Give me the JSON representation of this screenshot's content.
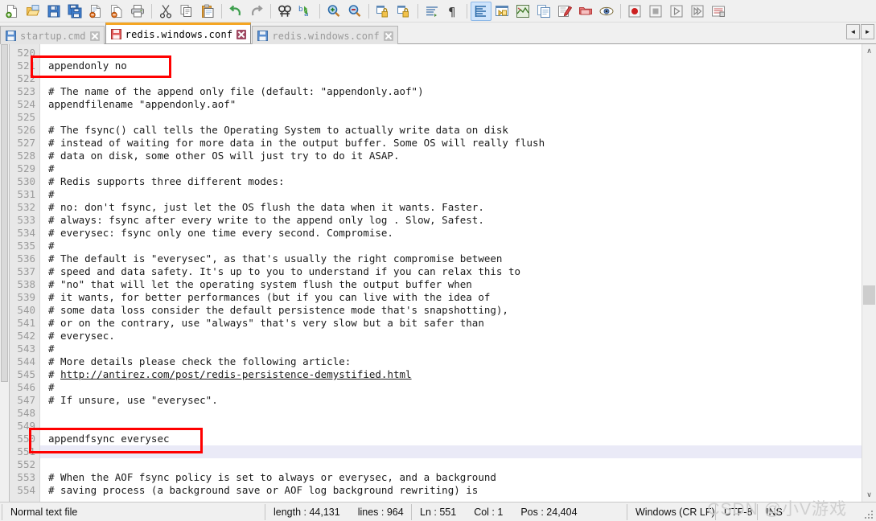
{
  "toolbar": {
    "items": [
      {
        "name": "new-file-icon",
        "label": "New"
      },
      {
        "name": "open-file-icon",
        "label": "Open"
      },
      {
        "name": "save-icon",
        "label": "Save"
      },
      {
        "name": "save-all-icon",
        "label": "Save All"
      },
      {
        "name": "close-file-icon",
        "label": "Close"
      },
      {
        "name": "close-all-icon",
        "label": "Close All"
      },
      {
        "name": "print-icon",
        "label": "Print"
      },
      {
        "name": "separator-1",
        "label": ""
      },
      {
        "name": "cut-icon",
        "label": "Cut"
      },
      {
        "name": "copy-icon",
        "label": "Copy"
      },
      {
        "name": "paste-icon",
        "label": "Paste"
      },
      {
        "name": "separator-2",
        "label": ""
      },
      {
        "name": "undo-icon",
        "label": "Undo"
      },
      {
        "name": "redo-icon",
        "label": "Redo"
      },
      {
        "name": "separator-3",
        "label": ""
      },
      {
        "name": "find-icon",
        "label": "Find"
      },
      {
        "name": "replace-icon",
        "label": "Replace"
      },
      {
        "name": "separator-4",
        "label": ""
      },
      {
        "name": "zoom-in-icon",
        "label": "Zoom In"
      },
      {
        "name": "zoom-out-icon",
        "label": "Zoom Out"
      },
      {
        "name": "separator-5",
        "label": ""
      },
      {
        "name": "sync-vertical-scroll-icon",
        "label": "Synchronize Vertical Scrolling"
      },
      {
        "name": "sync-horizontal-scroll-icon",
        "label": "Synchronize Horizontal Scrolling"
      },
      {
        "name": "separator-6",
        "label": ""
      },
      {
        "name": "word-wrap-icon",
        "label": "Word wrap"
      },
      {
        "name": "show-all-characters-icon",
        "label": "Show All Characters"
      },
      {
        "name": "separator-7",
        "label": ""
      },
      {
        "name": "show-indent-guide-icon",
        "label": "Show Indent Guide"
      },
      {
        "name": "user-defined-dialog-icon",
        "label": "User-Defined Dialogue"
      },
      {
        "name": "document-map-icon",
        "label": "Document Map"
      },
      {
        "name": "function-list-icon",
        "label": "Function List"
      },
      {
        "name": "folder-as-workspace-icon",
        "label": "Folder as Workspace"
      },
      {
        "name": "monitoring-icon",
        "label": "Monitoring"
      },
      {
        "name": "separator-8",
        "label": ""
      },
      {
        "name": "record-macro-icon",
        "label": "Start Recording"
      },
      {
        "name": "stop-macro-icon",
        "label": "Stop Recording"
      },
      {
        "name": "play-macro-icon",
        "label": "Playback"
      },
      {
        "name": "run-macro-multiple-icon",
        "label": "Run a Macro Multiple Times"
      },
      {
        "name": "save-macro-icon",
        "label": "Save Current Recorded Macro"
      }
    ]
  },
  "tabs": [
    {
      "label": "startup.cmd",
      "active": false,
      "saved": true
    },
    {
      "label": "redis.windows.conf",
      "active": true,
      "saved": false
    },
    {
      "label": "redis.windows.conf",
      "active": false,
      "saved": true
    }
  ],
  "tab_scroll": {
    "left": "◄",
    "right": "►"
  },
  "editor": {
    "first_line": 520,
    "current_line": 551,
    "lines": [
      {
        "n": 520,
        "text": ""
      },
      {
        "n": 521,
        "text": "appendonly no"
      },
      {
        "n": 522,
        "text": ""
      },
      {
        "n": 523,
        "text": "# The name of the append only file (default: \"appendonly.aof\")"
      },
      {
        "n": 524,
        "text": "appendfilename \"appendonly.aof\""
      },
      {
        "n": 525,
        "text": ""
      },
      {
        "n": 526,
        "text": "# The fsync() call tells the Operating System to actually write data on disk"
      },
      {
        "n": 527,
        "text": "# instead of waiting for more data in the output buffer. Some OS will really flush"
      },
      {
        "n": 528,
        "text": "# data on disk, some other OS will just try to do it ASAP."
      },
      {
        "n": 529,
        "text": "#"
      },
      {
        "n": 530,
        "text": "# Redis supports three different modes:"
      },
      {
        "n": 531,
        "text": "#"
      },
      {
        "n": 532,
        "text": "# no: don't fsync, just let the OS flush the data when it wants. Faster."
      },
      {
        "n": 533,
        "text": "# always: fsync after every write to the append only log . Slow, Safest."
      },
      {
        "n": 534,
        "text": "# everysec: fsync only one time every second. Compromise."
      },
      {
        "n": 535,
        "text": "#"
      },
      {
        "n": 536,
        "text": "# The default is \"everysec\", as that's usually the right compromise between"
      },
      {
        "n": 537,
        "text": "# speed and data safety. It's up to you to understand if you can relax this to"
      },
      {
        "n": 538,
        "text": "# \"no\" that will let the operating system flush the output buffer when"
      },
      {
        "n": 539,
        "text": "# it wants, for better performances (but if you can live with the idea of"
      },
      {
        "n": 540,
        "text": "# some data loss consider the default persistence mode that's snapshotting),"
      },
      {
        "n": 541,
        "text": "# or on the contrary, use \"always\" that's very slow but a bit safer than"
      },
      {
        "n": 542,
        "text": "# everysec."
      },
      {
        "n": 543,
        "text": "#"
      },
      {
        "n": 544,
        "text": "# More details please check the following article:"
      },
      {
        "n": 545,
        "text": "# http://antirez.com/post/redis-persistence-demystified.html",
        "url": "http://antirez.com/post/redis-persistence-demystified.html",
        "prefix": "# "
      },
      {
        "n": 546,
        "text": "#"
      },
      {
        "n": 547,
        "text": "# If unsure, use \"everysec\"."
      },
      {
        "n": 548,
        "text": ""
      },
      {
        "n": 549,
        "text": ""
      },
      {
        "n": 550,
        "text": "appendfsync everysec"
      },
      {
        "n": 551,
        "text": ""
      },
      {
        "n": 552,
        "text": ""
      },
      {
        "n": 553,
        "text": "# When the AOF fsync policy is set to always or everysec, and a background"
      },
      {
        "n": 554,
        "text": "# saving process (a background save or AOF log background rewriting) is"
      }
    ]
  },
  "annotations": [
    {
      "name": "highlight-appendonly",
      "target_line": 521
    },
    {
      "name": "highlight-appendfsync",
      "target_line": 550
    }
  ],
  "scrollbars": {
    "vertical_up": "∧",
    "vertical_down": "∨"
  },
  "statusbar": {
    "file_type": "Normal text file",
    "length_label": "length : 44,131",
    "lines_label": "lines : 964",
    "ln": "Ln : 551",
    "col": "Col : 1",
    "pos": "Pos : 24,404",
    "eol": "Windows (CR LF)",
    "encoding": "UTF-8",
    "insert_mode": "INS"
  },
  "watermark": "CSDN @小V游戏",
  "colors": {
    "accent_tab": "#f5a623",
    "annotation_red": "#ff0000",
    "current_line": "#eaeaf7",
    "gutter_bg": "#e8e8e8",
    "chrome_bg": "#f0f0f0"
  }
}
